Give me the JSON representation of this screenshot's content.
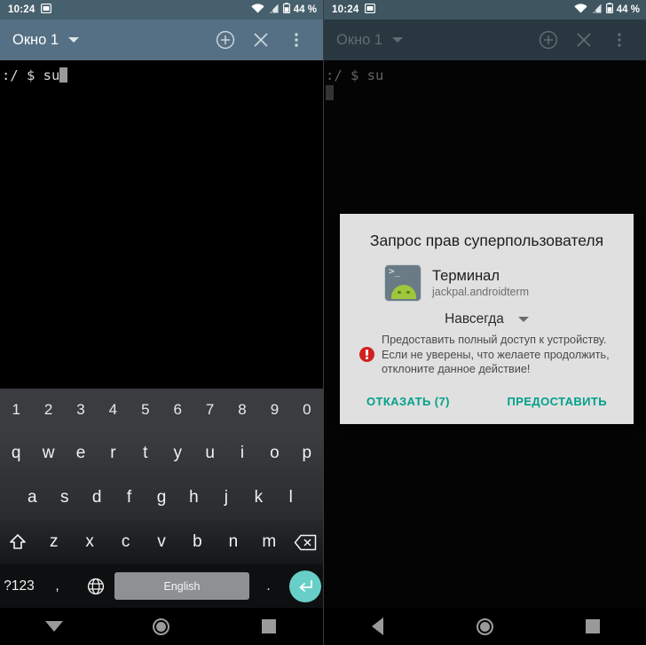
{
  "status_bar": {
    "time": "10:24",
    "screenshot_icon": "screenshot-icon",
    "wifi_icon": "wifi-icon",
    "signal_icon": "signal-no-service-icon",
    "battery_icon": "battery-icon",
    "battery_text": "44 %"
  },
  "toolbar": {
    "window_title": "Окно 1",
    "caret_icon": "chevron-down-icon",
    "add_icon": "add-window-icon",
    "close_icon": "close-window-icon",
    "overflow_icon": "overflow-menu-icon"
  },
  "terminal": {
    "left_line": ":/ $ su",
    "right_line": ":/ $ su"
  },
  "keyboard": {
    "row_numbers": [
      "1",
      "2",
      "3",
      "4",
      "5",
      "6",
      "7",
      "8",
      "9",
      "0"
    ],
    "row_q": [
      "q",
      "w",
      "e",
      "r",
      "t",
      "y",
      "u",
      "i",
      "o",
      "p"
    ],
    "row_a": [
      "a",
      "s",
      "d",
      "f",
      "g",
      "h",
      "j",
      "k",
      "l"
    ],
    "row_z": [
      "z",
      "x",
      "c",
      "v",
      "b",
      "n",
      "m"
    ],
    "shift_icon": "shift-icon",
    "backspace_icon": "backspace-icon",
    "symbols_label": "?123",
    "comma_label": ",",
    "globe_icon": "language-globe-icon",
    "spacebar_label": "English",
    "period_label": ".",
    "enter_icon": "enter-icon"
  },
  "nav_bar": {
    "left_back_icon": "hide-keyboard-icon",
    "right_back_icon": "back-icon",
    "home_icon": "home-icon",
    "recents_icon": "recents-icon"
  },
  "dialog": {
    "title": "Запрос прав суперпользователя",
    "app_icon": "terminal-app-icon",
    "app_icon_prompt": ">_",
    "app_name": "Терминал",
    "app_package": "jackpal.androidterm",
    "duration_value": "Навсегда",
    "duration_caret_icon": "chevron-down-icon",
    "warning_icon": "warning-icon",
    "warning_line1": "Предоставить полный доступ к устройству.",
    "warning_line2": "Если не уверены, что желаете продолжить,",
    "warning_line3": "отклоните данное действие!",
    "deny_label": "ОТКАЗАТЬ (7)",
    "grant_label": "ПРЕДОСТАВИТЬ"
  },
  "colors": {
    "toolbar": "#557084",
    "status_bar": "#47606d",
    "accent_teal": "#00a08a",
    "enter_key": "#67cfc8",
    "warning_red": "#d32020",
    "dialog_bg": "#e0e0e0"
  }
}
